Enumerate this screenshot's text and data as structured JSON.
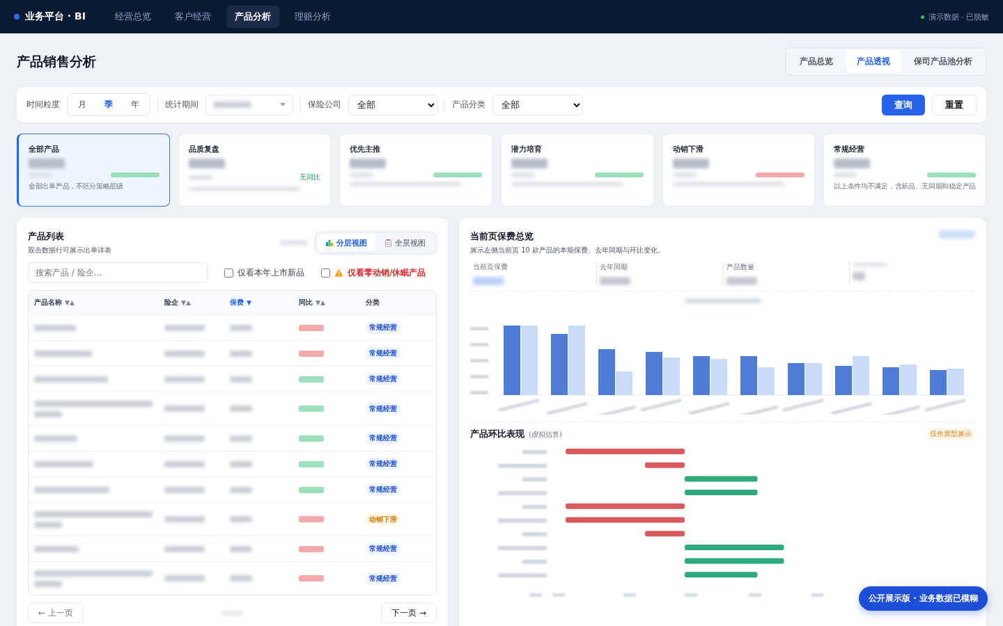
{
  "topbar": {
    "brand": "业务平台 · BI",
    "nav": [
      {
        "label": "经营总览",
        "selected": false
      },
      {
        "label": "客户经营",
        "selected": false
      },
      {
        "label": "产品分析",
        "selected": true
      },
      {
        "label": "理赔分析",
        "selected": false
      }
    ],
    "status": "演示数据 · 已脱敏"
  },
  "page": {
    "title": "产品销售分析",
    "view_tabs": [
      {
        "label": "产品总览",
        "selected": false
      },
      {
        "label": "产品透视",
        "selected": true
      },
      {
        "label": "保司产品池分析",
        "selected": false
      }
    ]
  },
  "filters": {
    "granularity": {
      "label": "时间粒度",
      "options": [
        {
          "label": "月",
          "selected": false
        },
        {
          "label": "季",
          "selected": true
        },
        {
          "label": "年",
          "selected": false
        }
      ]
    },
    "period": {
      "label": "统计期间"
    },
    "company": {
      "label": "保险公司",
      "value": "全部"
    },
    "category": {
      "label": "产品分类",
      "value": "全部"
    },
    "buttons": [
      {
        "label": "查询",
        "kind": "primary"
      },
      {
        "label": "重置",
        "kind": "secondary"
      }
    ]
  },
  "cards": [
    {
      "title": "全部产品",
      "selected": true,
      "color": "#9be0b8",
      "note": "全部出单产品，不区分策略层级"
    },
    {
      "title": "品质复盘",
      "selected": false,
      "change": "无同比"
    },
    {
      "title": "优先主推",
      "selected": false,
      "color": "#9be0b8"
    },
    {
      "title": "潜力培育",
      "selected": false,
      "color": "#9be0b8"
    },
    {
      "title": "动销下滑",
      "selected": false,
      "color": "#f3a9a9"
    },
    {
      "title": "常规经营",
      "selected": false,
      "color": "#9be0b8",
      "note": "以上条件均不满足，含新品、无同期和稳定产品"
    }
  ],
  "product_list": {
    "title": "产品列表",
    "subtitle": "双击数据行可展示出单详表",
    "views": [
      {
        "label": "分层视图",
        "selected": true
      },
      {
        "label": "全景视图",
        "selected": false
      }
    ],
    "search": {
      "placeholder": "搜索产品 / 险企…"
    },
    "filters": [
      {
        "label": "仅看本年上市新品",
        "checked": false,
        "kind": "plain"
      },
      {
        "label": "仅看零动销/休眠产品",
        "checked": false,
        "kind": "warning"
      }
    ],
    "columns": [
      {
        "label": "产品名称",
        "sort_icon": "▼▲",
        "selected": false
      },
      {
        "label": "险企",
        "sort_icon": "▼▲",
        "selected": false
      },
      {
        "label": "保费",
        "sort_icon": "▼",
        "selected": true
      },
      {
        "label": "同比",
        "sort_icon": "▼▲",
        "selected": false
      },
      {
        "label": "分类",
        "selected": false
      }
    ],
    "rows": [
      {
        "category": "常规经营",
        "kind": "regular",
        "color": "#f3a9a9"
      },
      {
        "category": "常规经营",
        "kind": "regular",
        "color": "#f3a9a9"
      },
      {
        "category": "常规经营",
        "kind": "regular",
        "color": "#9be0b8"
      },
      {
        "category": "常规经营",
        "kind": "regular",
        "color": "#9be0b8"
      },
      {
        "category": "常规经营",
        "kind": "regular",
        "color": "#9be0b8"
      },
      {
        "category": "常规经营",
        "kind": "regular",
        "color": "#9be0b8"
      },
      {
        "category": "常规经营",
        "kind": "regular",
        "color": "#9be0b8"
      },
      {
        "category": "动销下滑",
        "kind": "declining",
        "color": "#f3a9a9"
      },
      {
        "category": "常规经营",
        "kind": "regular",
        "color": "#f3a9a9"
      },
      {
        "category": "常规经营",
        "kind": "regular",
        "color": "#f3a9a9"
      }
    ],
    "pager": {
      "prev": "← 上一页",
      "next": "下一页 →"
    }
  },
  "overview": {
    "title": "当前页保费总览",
    "subtitle": "展示左侧当前页 10 款产品的本期保费、去年同期与环比变化。",
    "stats": [
      {
        "label": "当前页保费"
      },
      {
        "label": "去年同期"
      },
      {
        "label": "产品数量"
      }
    ],
    "trend_title": "产品环比表现",
    "trend_note": "(虚拟估算)",
    "trend_badge": "仅作原型展示"
  },
  "floating_badge": "公开展示版 · 业务数据已模糊"
}
